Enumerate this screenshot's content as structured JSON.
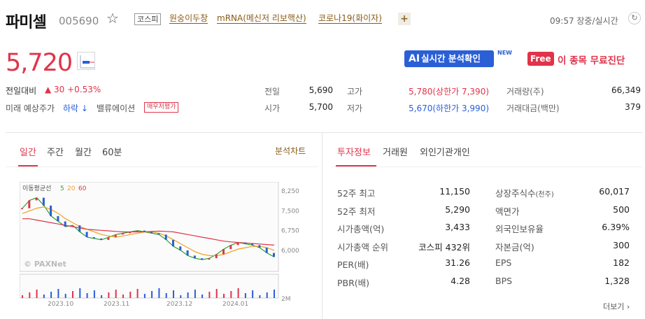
{
  "header": {
    "name": "파미셀",
    "code": "005690",
    "market": "코스피",
    "themes": [
      "원숭이두창",
      "mRNA(메신저 리보핵산)",
      "코로나19(화이자)"
    ],
    "time": "09:57 장중/실시간"
  },
  "price": {
    "current": "5,720",
    "prev_label": "전일대비",
    "change": "▲ 30 +0.53%",
    "forecast_label": "미래 예상주가",
    "forecast_value": "하락 ↓",
    "valuation_label": "밸류에이션",
    "valuation_badge": "매우저평가",
    "ai_button": {
      "ai": "AI",
      "label": "실시간 분석확인"
    },
    "new_tag": "NEW",
    "free_tag": "Free",
    "free_text": "이 종목 무료진단"
  },
  "quote": {
    "prev_close_label": "전일",
    "prev_close": "5,690",
    "open_label": "시가",
    "open": "5,700",
    "high_label": "고가",
    "high": "5,780(상한가 7,390)",
    "low_label": "저가",
    "low": "5,670(하한가 3,990)",
    "volume_label": "거래량(주)",
    "volume": "66,349",
    "amount_label": "거래대금(백만)",
    "amount": "379"
  },
  "chart_tabs": [
    "일간",
    "주간",
    "월간",
    "60분"
  ],
  "chart_link": "분석차트",
  "info_tabs": [
    "투자정보",
    "거래원",
    "외인기관개인"
  ],
  "chart_data": {
    "type": "line",
    "legend_label": "이동평균선",
    "ma_names": [
      "5",
      "20",
      "60"
    ],
    "x": [
      "2023.10",
      "2023.11",
      "2023.12",
      "2024.01"
    ],
    "y_ticks": [
      "8,250",
      "7,500",
      "6,750",
      "6,000"
    ],
    "volume_tick": "2M",
    "watermark": "© PAXNet",
    "ylim": [
      5200,
      8600
    ],
    "series": [
      {
        "name": "5",
        "values": [
          7600,
          7900,
          8000,
          7700,
          7300,
          7100,
          6900,
          6950,
          6700,
          6500,
          6450,
          6400,
          6500,
          6600,
          6650,
          6700,
          6750,
          6700,
          6650,
          6600,
          6400,
          6150,
          6000,
          5800,
          5700,
          5650,
          5700,
          5850,
          6050,
          6200,
          6300,
          6250,
          6200,
          6100,
          5900,
          5750
        ]
      },
      {
        "name": "20",
        "values": [
          7400,
          7500,
          7600,
          7650,
          7550,
          7400,
          7200,
          7050,
          6900,
          6800,
          6700,
          6600,
          6550,
          6500,
          6550,
          6600,
          6650,
          6700,
          6700,
          6650,
          6550,
          6400,
          6250,
          6100,
          5950,
          5850,
          5800,
          5800,
          5850,
          5950,
          6050,
          6100,
          6150,
          6150,
          6100,
          6000
        ]
      },
      {
        "name": "60",
        "values": [
          7200,
          7200,
          7150,
          7100,
          7050,
          7000,
          6950,
          6900,
          6850,
          6800,
          6780,
          6760,
          6740,
          6720,
          6700,
          6700,
          6700,
          6710,
          6720,
          6730,
          6720,
          6700,
          6650,
          6600,
          6550,
          6500,
          6450,
          6400,
          6350,
          6320,
          6300,
          6280,
          6260,
          6240,
          6220,
          6200
        ]
      }
    ],
    "colors": {
      "ma5": "#2aa52a",
      "ma20": "#f0a020",
      "ma60": "#e0344a"
    }
  },
  "investment": {
    "left": [
      {
        "label": "52주 최고",
        "value": "11,150"
      },
      {
        "label": "52주 최저",
        "value": "5,290"
      },
      {
        "label": "시가총액(억)",
        "value": "3,433"
      },
      {
        "label": "시가총액 순위",
        "value": "코스피 432위"
      },
      {
        "label": "PER(배)",
        "value": "31.26"
      },
      {
        "label": "PBR(배)",
        "value": "4.28"
      }
    ],
    "right": [
      {
        "label": "상장주식수",
        "sub": "(천주)",
        "value": "60,017"
      },
      {
        "label": "액면가",
        "sub": "",
        "value": "500"
      },
      {
        "label": "외국인보유율",
        "sub": "",
        "value": "6.39%"
      },
      {
        "label": "자본금(억)",
        "sub": "",
        "value": "300"
      },
      {
        "label": "EPS",
        "sub": "",
        "value": "182"
      },
      {
        "label": "BPS",
        "sub": "",
        "value": "1,328"
      }
    ],
    "more": "더보기 ›"
  }
}
